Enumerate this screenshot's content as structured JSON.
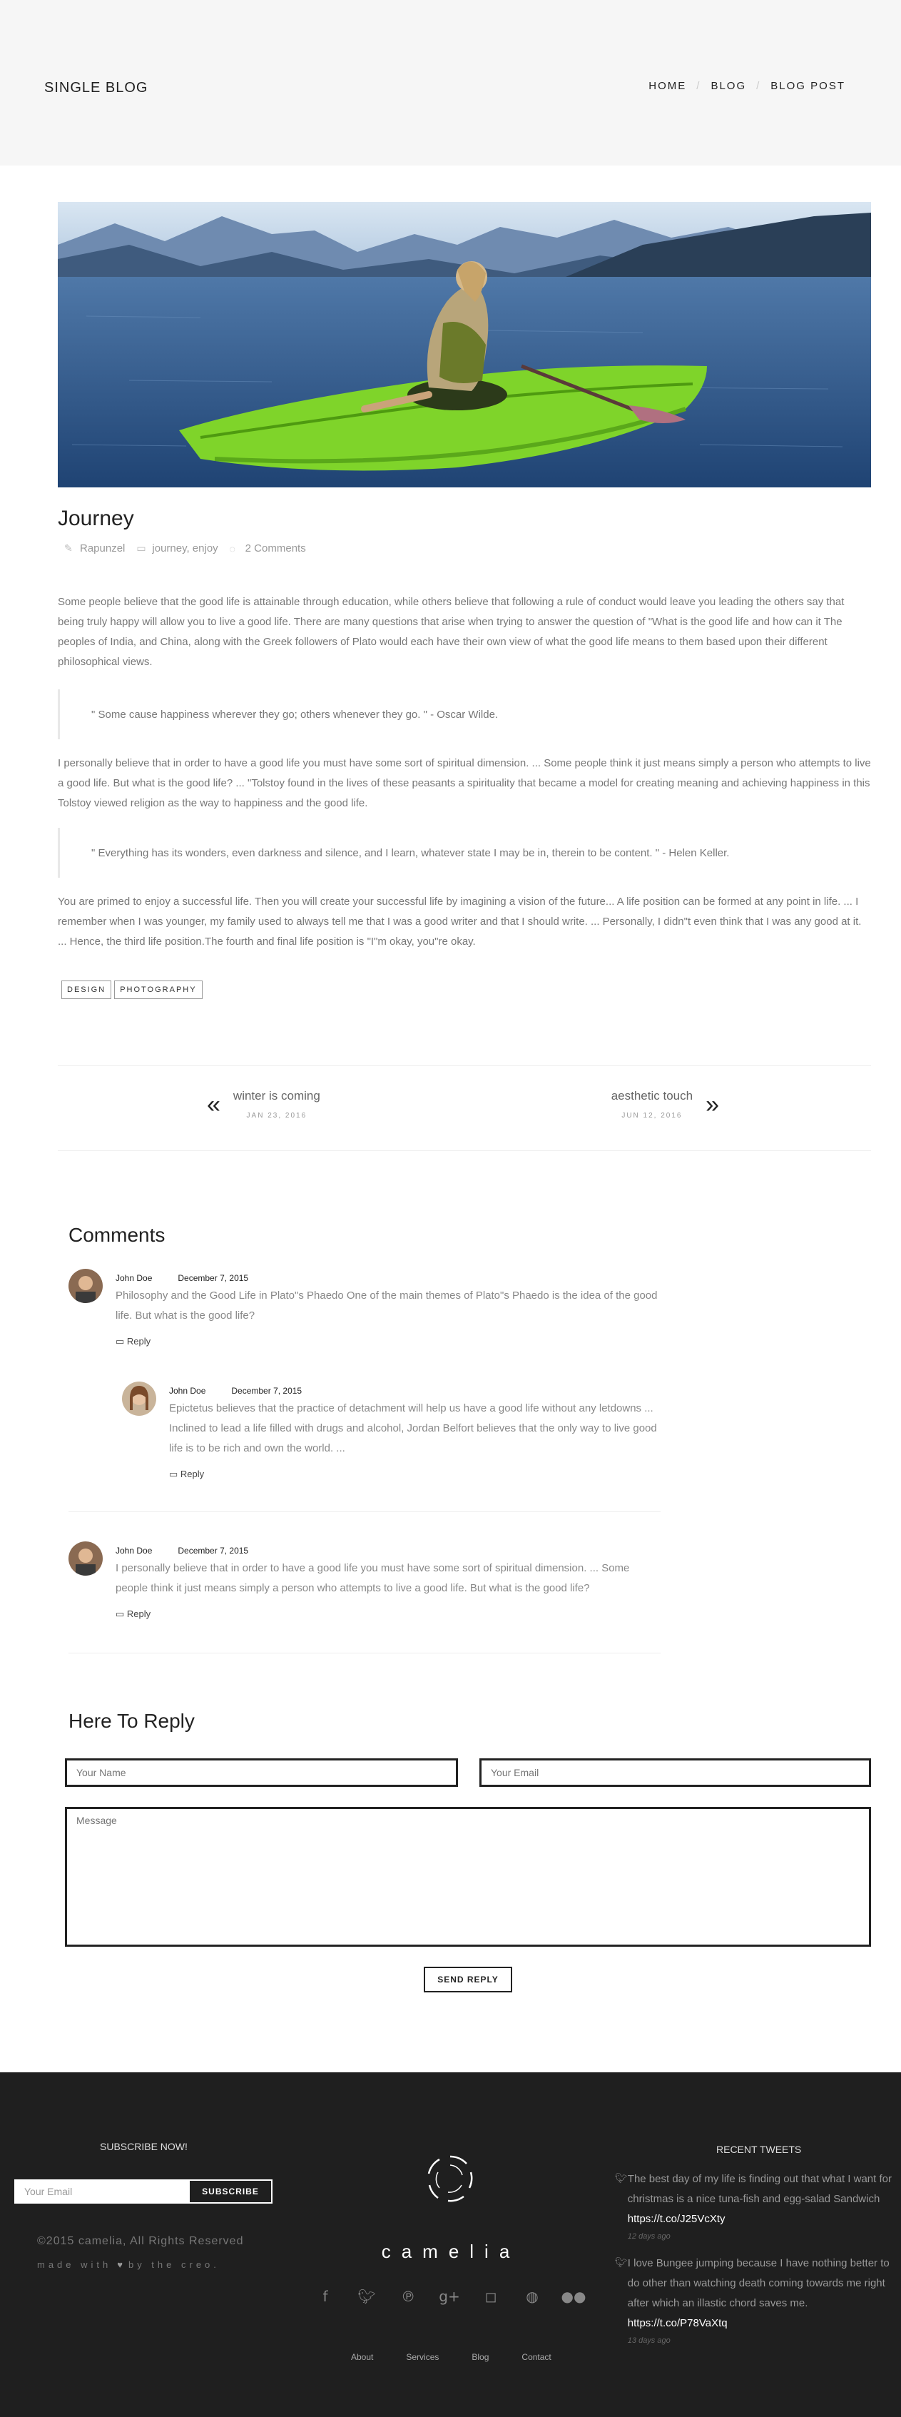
{
  "header": {
    "title": "SINGLE BLOG",
    "breadcrumb": [
      "HOME",
      "BLOG",
      "BLOG POST"
    ]
  },
  "post": {
    "title": "Journey",
    "author": "Rapunzel",
    "categories": "journey,  enjoy",
    "comments": "2 Comments",
    "p1": "Some people believe that the good life is attainable through education, while others believe that following a rule of conduct would leave you leading the others say that being truly happy will allow you to live a good life. There are many questions that arise when trying to answer the question of \"What is the good life and how can it The peoples of India, and China, along with the Greek followers of Plato would each have their own view of what the good life means to them based upon their different philosophical views.",
    "quote1": "\" Some cause happiness wherever they go; others whenever they go. \" - Oscar Wilde.",
    "p2": "I personally believe that in order to have a good life you must have some sort of spiritual dimension. ... Some people think it just means simply a person who attempts to live a good life. But what is the good life? ... \"Tolstoy found in the lives of these peasants a spirituality that became a model for creating meaning and achieving happiness in this Tolstoy viewed religion as the way to happiness and the good life.",
    "quote2": "\" Everything has its wonders, even darkness and silence, and I learn, whatever state I may be in, therein to be content. \" - Helen Keller.",
    "p3": "You are primed to enjoy a successful life. Then you will create your successful life by imagining a vision of the future... A life position can be formed at any point in life. ... I remember when I was younger, my family used to always tell me that I was a good writer and that I should write. ... Personally, I didn\"t even think that I was any good at it. ... Hence, the third life position.The fourth and final life position is \"I\"m okay, you\"re okay.",
    "tags": [
      "DESIGN",
      "PHOTOGRAPHY"
    ]
  },
  "post_nav": {
    "prev_title": "winter is coming",
    "prev_date": "JAN 23, 2016",
    "prev_arrow": "«",
    "next_title": "aesthetic touch",
    "next_date": "JUN 12, 2016",
    "next_arrow": "»"
  },
  "comments": {
    "title": "Comments",
    "reply_label": "Reply",
    "items": [
      {
        "name": "John Doe",
        "date": "December 7, 2015",
        "text": "Philosophy and the Good Life in Plato\"s Phaedo One of the main themes of Plato\"s Phaedo is the idea of the good life. But what is the good life?"
      },
      {
        "name": "John Doe",
        "date": "December 7, 2015",
        "text": "Epictetus believes that the practice of detachment will help us have a good life without any letdowns ... Inclined to lead a life filled with drugs and alcohol, Jordan Belfort believes that the only way to live good life is to be rich and own the world. ..."
      },
      {
        "name": "John Doe",
        "date": "December 7, 2015",
        "text": "I personally believe that in order to have a good life you must have some sort of spiritual dimension. ... Some people think it just means simply a person who attempts to live a good life. But what is the good life?"
      }
    ]
  },
  "reply_form": {
    "title": "Here To Reply",
    "name_placeholder": "Your Name",
    "email_placeholder": "Your Email",
    "message_placeholder": "Message",
    "submit": "SEND REPLY"
  },
  "footer": {
    "subscribe_title": "SUBSCRIBE NOW!",
    "subscribe_placeholder": "Your Email",
    "subscribe_button": "SUBSCRIBE",
    "copyright": "©2015 camelia, All Rights Reserved",
    "made_with_1": "made with",
    "made_with_2": "by the creo.",
    "brand": "camelia",
    "social_icons": [
      "facebook-icon",
      "twitter-icon",
      "pinterest-icon",
      "google-plus-icon",
      "instagram-icon",
      "dribbble-icon",
      "flickr-icon"
    ],
    "links": [
      "About",
      "Services",
      "Blog",
      "Contact"
    ],
    "tweets_title": "RECENT TWEETS",
    "tweets": [
      {
        "text": "The best day of my life is finding out that what I want for christmas is a nice tuna-fish and egg-salad Sandwich",
        "link": "https://t.co/J25VcXty",
        "time": "12 days ago"
      },
      {
        "text": "I love Bungee jumping because I have nothing better to do other than watching death coming towards me right after which an illastic chord saves me.",
        "link": "https://t.co/P78VaXtq",
        "time": "13 days ago"
      }
    ]
  }
}
